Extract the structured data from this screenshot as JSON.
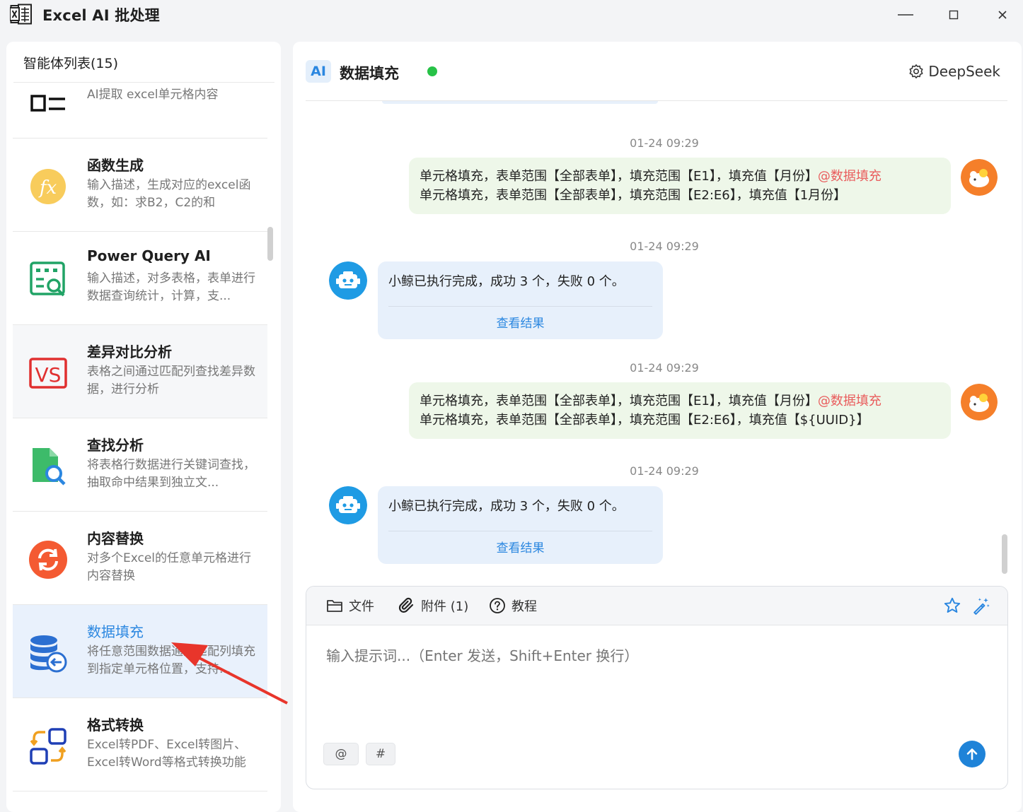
{
  "window": {
    "title": "Excel AI 批处理",
    "minimize_icon": "minimize-icon",
    "maximize_icon": "maximize-icon",
    "close_icon": "close-icon"
  },
  "sidebar": {
    "header": "智能体列表(15)",
    "partial_item_desc": "AI提取 excel单元格内容",
    "items": [
      {
        "name": "函数生成",
        "desc": "输入描述，生成对应的excel函数，如：求B2，C2的和",
        "icon": "fx-icon"
      },
      {
        "name": "Power Query AI",
        "desc": "输入描述，对多表格，表单进行数据查询统计，计算，支...",
        "icon": "table-search-icon"
      },
      {
        "name": "差异对比分析",
        "desc": "表格之间通过匹配列查找差异数据，进行分析",
        "icon": "vs-icon"
      },
      {
        "name": "查找分析",
        "desc": "将表格行数据进行关键词查找，抽取命中结果到独立文...",
        "icon": "file-search-icon"
      },
      {
        "name": "内容替换",
        "desc": "对多个Excel的任意单元格进行内容替换",
        "icon": "replace-icon"
      },
      {
        "name": "数据填充",
        "desc": "将任意范围数据通过匹配列填充到指定单元格位置，支持...",
        "icon": "database-fill-icon"
      },
      {
        "name": "格式转换",
        "desc": "Excel转PDF、Excel转图片、Excel转Word等格式转换功能",
        "icon": "format-convert-icon"
      }
    ]
  },
  "main": {
    "badge": "AI",
    "title": "数据填充",
    "status_color": "#27c247",
    "model": "DeepSeek",
    "messages": [
      {
        "type": "user",
        "time": "01-24 09:29",
        "line1": "单元格填充，表单范围【全部表单】，填充范围【E1】，填充值【月份】",
        "mention": "@数据填充",
        "line2": "单元格填充，表单范围【全部表单】，填充范围【E2:E6】，填充值【1月份】"
      },
      {
        "type": "bot",
        "time": "01-24 09:29",
        "text": "小鲸已执行完成，成功 3 个，失败 0 个。",
        "link": "查看结果"
      },
      {
        "type": "user",
        "time": "01-24 09:29",
        "line1": "单元格填充，表单范围【全部表单】，填充范围【E1】，填充值【月份】",
        "mention": "@数据填充",
        "line2": "单元格填充，表单范围【全部表单】，填充范围【E2:E6】，填充值【${UUID}】"
      },
      {
        "type": "bot",
        "time": "01-24 09:29",
        "text": "小鲸已执行完成，成功 3 个，失败 0 个。",
        "link": "查看结果"
      }
    ]
  },
  "composer": {
    "tools": {
      "file": "文件",
      "attachment": "附件 (1)",
      "tutorial": "教程"
    },
    "placeholder": "输入提示词...（Enter 发送，Shift+Enter 换行）",
    "chip_at": "@",
    "chip_hash": "#"
  },
  "colors": {
    "accent": "#2b87e0",
    "user_bubble": "#eef7e9",
    "bot_bubble": "#e7f0fb",
    "mention": "#e95c5c"
  }
}
